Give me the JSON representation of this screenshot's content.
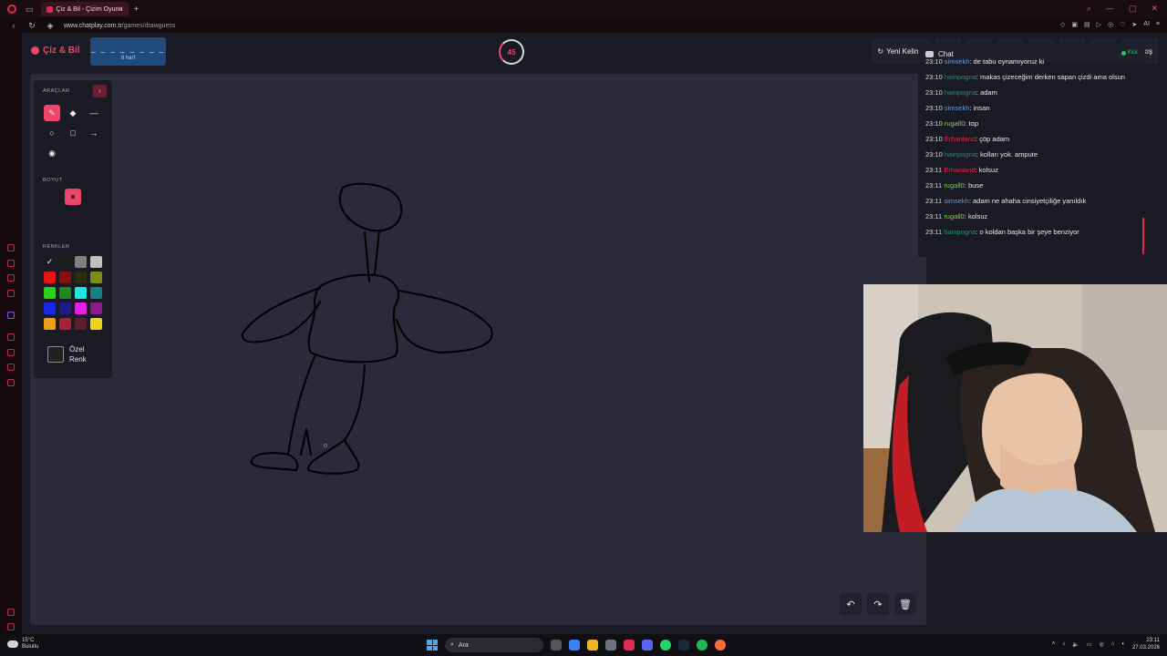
{
  "browser": {
    "tab_title": "Çiz & Bil - Çizim Oyunu",
    "url_domain": "www.chatplay.com.tr",
    "url_path": "/games/drawguess",
    "ai_label": "AI"
  },
  "header": {
    "logo": "Çiz & Bil",
    "word_mask": "_ _ _ _ _ _ _ _",
    "word_count": "8 harf",
    "timer": "45",
    "new_word": "Yeni Kelime",
    "exit": "Çıkış"
  },
  "tools": {
    "section_tools": "ARAÇLAR",
    "section_size": "BOYUT",
    "section_colors": "RENKLER",
    "custom_line1": "Özel",
    "custom_line2": "Renk",
    "swatches": [
      [
        "#111111",
        "#1b1b1b",
        "#808080",
        "#c0c0c0"
      ],
      [
        "#e81313",
        "#8b0e0e",
        "#2b2b10",
        "#7f8c17"
      ],
      [
        "#2ad21a",
        "#1e8a1e",
        "#1ee6e6",
        "#178080"
      ],
      [
        "#1627e6",
        "#1b1b8c",
        "#e61ee6",
        "#8a1b8a"
      ],
      [
        "#f0a016",
        "#a8203a",
        "#5a2030",
        "#f0d416"
      ]
    ],
    "accent": "#f0456b"
  },
  "chat": {
    "title": "Chat",
    "kick": "Kick",
    "messages": [
      {
        "time": "23:10",
        "user": "simsekh",
        "text": ": de tabu oynamıyoruz ki",
        "color": "#6b9bd6"
      },
      {
        "time": "23:10",
        "user": "hainpogna",
        "text": ": makas çizeceğim derken sapan çizdi ama olsun",
        "color": "#2a8a7a"
      },
      {
        "time": "23:10",
        "user": "hainpogna",
        "text": ": adam",
        "color": "#2a8a7a"
      },
      {
        "time": "23:10",
        "user": "simsekh",
        "text": ": insan",
        "color": "#6b9bd6"
      },
      {
        "time": "23:10",
        "user": "rugall0",
        "text": ": top",
        "color": "#7fd44a"
      },
      {
        "time": "23:10",
        "user": "Erhanland",
        "text": ": çöp adam",
        "color": "#e0294f"
      },
      {
        "time": "23:10",
        "user": "hainpogna",
        "text": ": kolları yok. ampute",
        "color": "#2a8a7a"
      },
      {
        "time": "23:11",
        "user": "Erhanland",
        "text": ": kolsuz",
        "color": "#e0294f"
      },
      {
        "time": "23:11",
        "user": "rugall0",
        "text": ": buse",
        "color": "#7fd44a"
      },
      {
        "time": "23:11",
        "user": "simsekh",
        "text": ": adam ne ahaha cinsiyetçiliğe yanıldık",
        "color": "#6b9bd6"
      },
      {
        "time": "23:11",
        "user": "rugall0",
        "text": ": kolsuz",
        "color": "#7fd44a"
      },
      {
        "time": "23:11",
        "user": "hainpogna",
        "text": ": o koldan başka bir şeye benziyor",
        "color": "#2a8a7a"
      }
    ]
  },
  "taskbar": {
    "temp": "15°C",
    "weather": "Bulutlu",
    "search": "Ara",
    "time": "23:11",
    "date": "27.03.2026"
  }
}
